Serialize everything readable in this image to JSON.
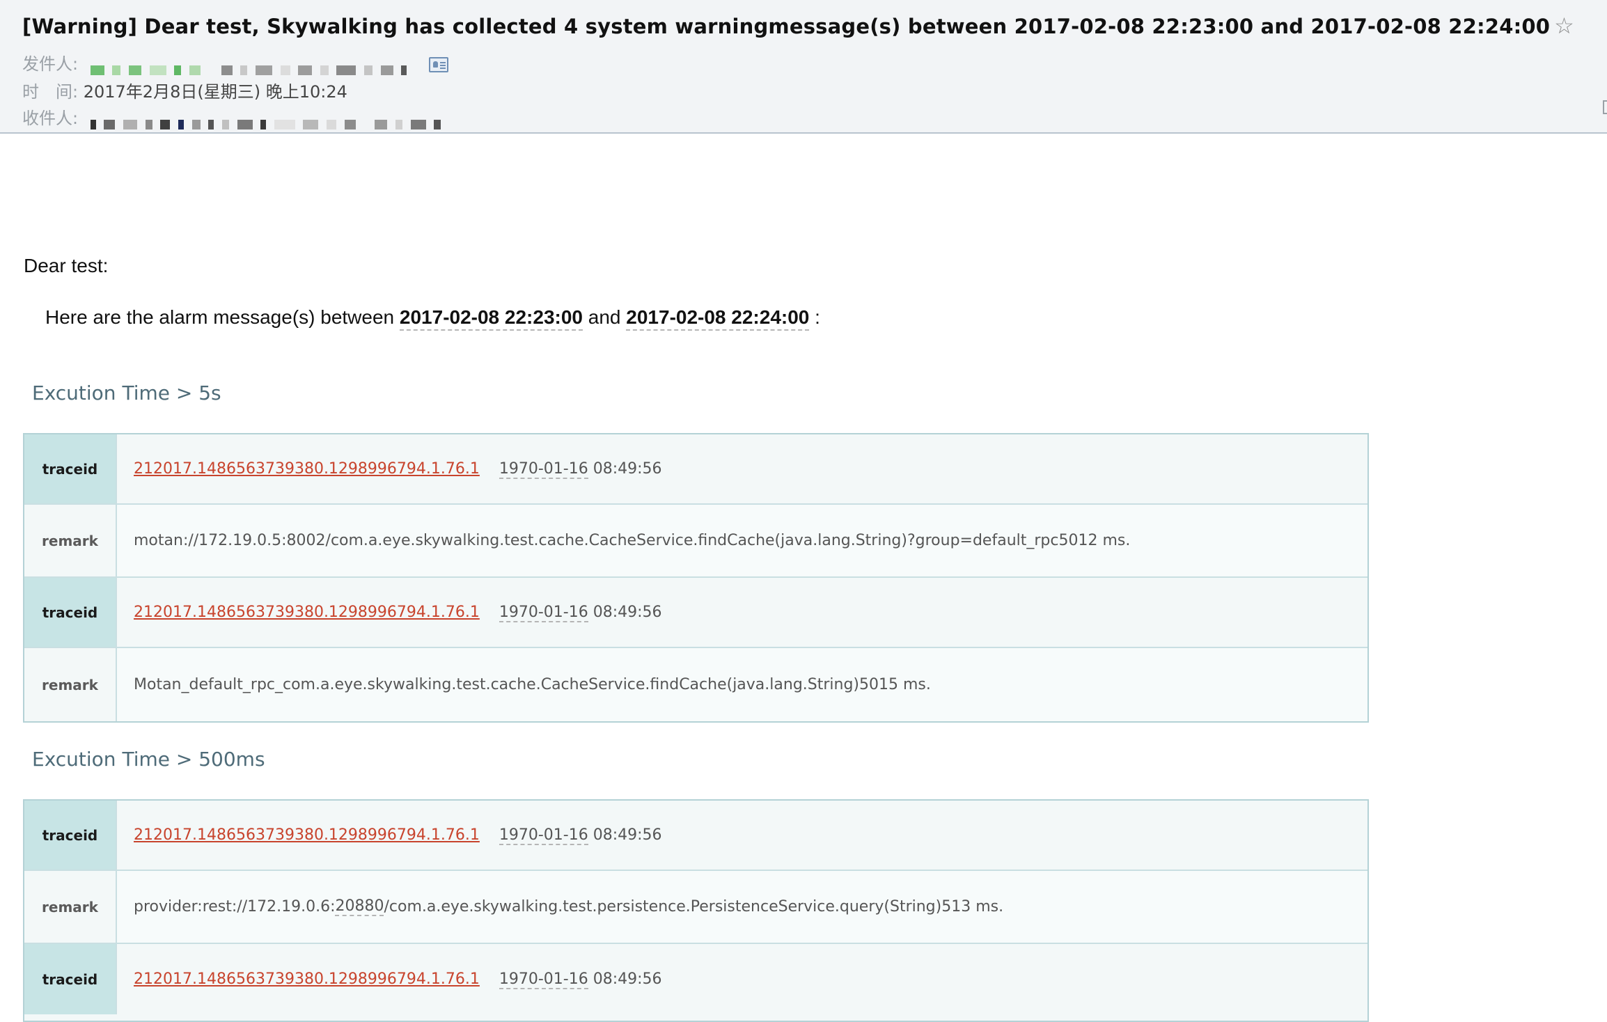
{
  "mail": {
    "subject": "[Warning] Dear test, Skywalking has collected 4 system warningmessage(s) between 2017-02-08 22:23:00 and 2017-02-08 22:24:00",
    "star_glyph": "☆",
    "from_label": "发件人:",
    "time_label": "时　间:",
    "time_value": "2017年2月8日(星期三) 晚上10:24",
    "to_label": "收件人:"
  },
  "body": {
    "greeting": "Dear test:",
    "intro_prefix": "Here are the alarm message(s) between",
    "intro_start": "2017-02-08 22:23:00",
    "intro_and": "and",
    "intro_end": "2017-02-08 22:24:00",
    "intro_suffix": ":"
  },
  "sections": [
    {
      "title": "Excution Time > 5s",
      "rows": [
        {
          "key": "traceid",
          "traceid": "212017.1486563739380.1298996794.1.76.1",
          "date": "1970-01-16",
          "time": "08:49:56"
        },
        {
          "key": "remark",
          "remark_pre": "motan://172.19.0.5:8002/com.a.eye.skywalking.test.cache.CacheService.findCache(java.lang.String)?group=default_rpc5012 ms.",
          "remark_dashed": "",
          "remark_post": ""
        },
        {
          "key": "traceid",
          "traceid": "212017.1486563739380.1298996794.1.76.1",
          "date": "1970-01-16",
          "time": "08:49:56"
        },
        {
          "key": "remark",
          "remark_pre": "Motan_default_rpc_com.a.eye.skywalking.test.cache.CacheService.findCache(java.lang.String)5015 ms.",
          "remark_dashed": "",
          "remark_post": ""
        }
      ]
    },
    {
      "title": "Excution Time > 500ms",
      "rows": [
        {
          "key": "traceid",
          "traceid": "212017.1486563739380.1298996794.1.76.1",
          "date": "1970-01-16",
          "time": "08:49:56"
        },
        {
          "key": "remark",
          "remark_pre": "provider:rest://172.19.0.6:",
          "remark_dashed": "20880",
          "remark_post": "/com.a.eye.skywalking.test.persistence.PersistenceService.query(String)513 ms."
        },
        {
          "key": "traceid",
          "traceid": "212017.1486563739380.1298996794.1.76.1",
          "date": "1970-01-16",
          "time": "08:49:56"
        }
      ]
    }
  ],
  "colors": {
    "header_bg": "#f2f4f6",
    "section_title": "#4e6b78",
    "trace_link": "#c8442d",
    "key_cell_bg": "#c7e4e5",
    "table_border": "#b4d2d6"
  },
  "icons": {
    "star": "star-icon",
    "contact": "contact-card-icon"
  }
}
